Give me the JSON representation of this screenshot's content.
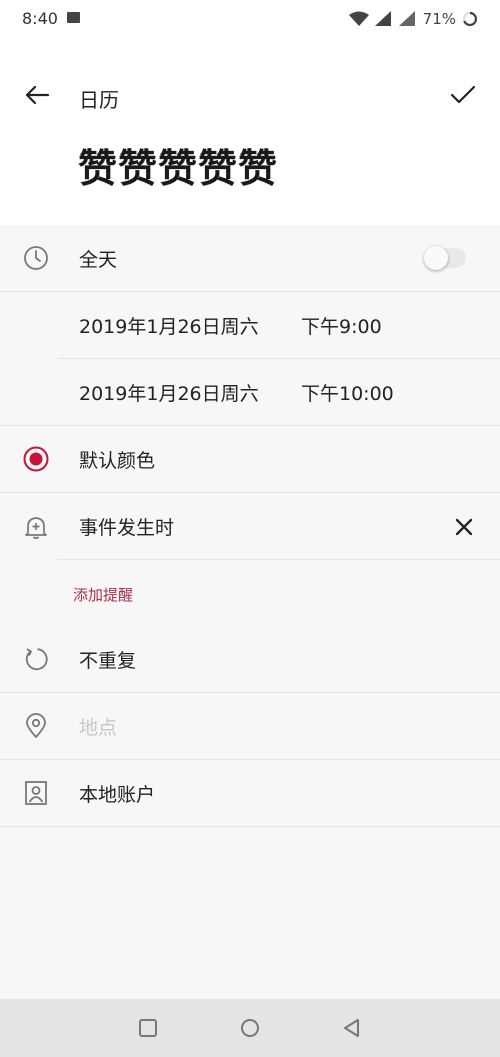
{
  "status_bar": {
    "time": "8:40",
    "battery": "71%",
    "network": "4G"
  },
  "header": {
    "section_title": "日历",
    "event_title": "赞赞赞赞赞"
  },
  "rows": {
    "all_day": {
      "label": "全天",
      "enabled": false
    },
    "start": {
      "date": "2019年1月26日周六",
      "time": "下午9:00"
    },
    "end": {
      "date": "2019年1月26日周六",
      "time": "下午10:00"
    },
    "color": {
      "label": "默认颜色",
      "value": "#c4163a"
    },
    "reminder": {
      "label": "事件发生时"
    },
    "add_reminder": "添加提醒",
    "repeat": {
      "label": "不重复"
    },
    "location": {
      "placeholder": "地点"
    },
    "account": {
      "label": "本地账户"
    }
  },
  "icons": {
    "back": "arrow-left-icon",
    "confirm": "check-icon",
    "all_day": "clock-icon",
    "color": "radio-dot-icon",
    "reminder": "bell-plus-icon",
    "reminder_remove": "close-icon",
    "repeat": "repeat-icon",
    "location": "location-pin-icon",
    "account": "person-card-icon"
  },
  "colors": {
    "accent": "#a8324a",
    "color_dot": "#c4163a"
  }
}
